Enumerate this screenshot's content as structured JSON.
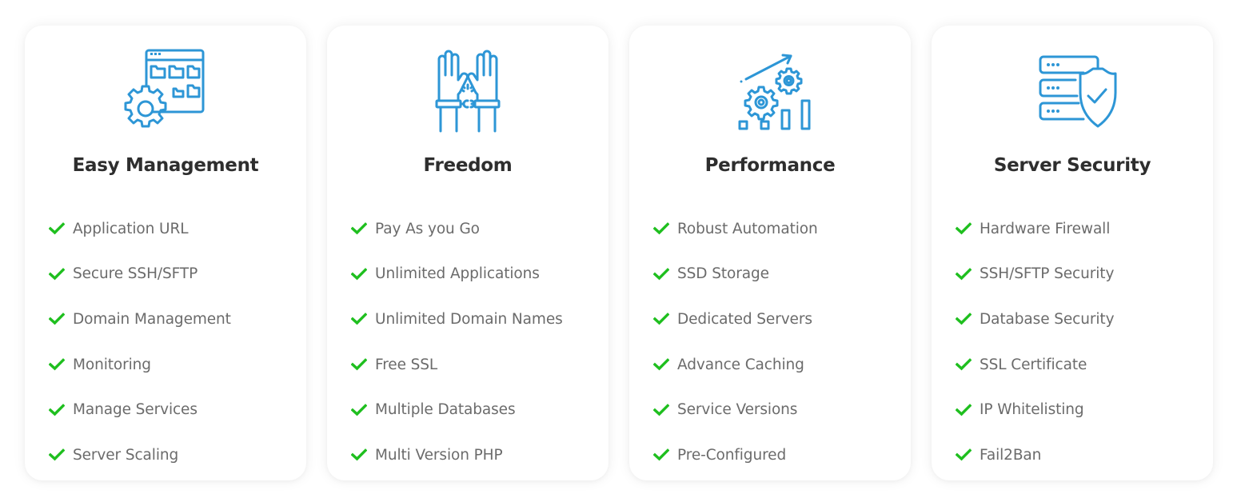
{
  "theme": {
    "icon_color": "#2d96d6",
    "check_color": "#1fbf1f",
    "title_color": "#2e2e2e",
    "text_color": "#6b6b6b"
  },
  "cards": [
    {
      "icon": "file-manager-gear-icon",
      "title": "Easy Management",
      "features": [
        "Application URL",
        "Secure SSH/SFTP",
        "Domain Management",
        "Monitoring",
        "Manage Services",
        "Server Scaling"
      ]
    },
    {
      "icon": "hands-broken-cuffs-icon",
      "title": "Freedom",
      "features": [
        "Pay As you Go",
        "Unlimited Applications",
        "Unlimited Domain Names",
        "Free SSL",
        "Multiple Databases",
        "Multi Version PHP"
      ]
    },
    {
      "icon": "performance-gears-chart-icon",
      "title": "Performance",
      "features": [
        "Robust Automation",
        "SSD Storage",
        "Dedicated Servers",
        "Advance Caching",
        "Service Versions",
        "Pre-Configured"
      ]
    },
    {
      "icon": "server-shield-icon",
      "title": "Server Security",
      "features": [
        "Hardware Firewall",
        "SSH/SFTP Security",
        "Database Security",
        "SSL Certificate",
        "IP Whitelisting",
        "Fail2Ban"
      ]
    }
  ]
}
